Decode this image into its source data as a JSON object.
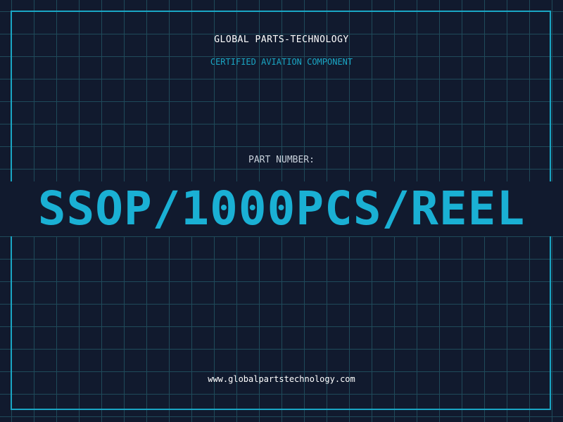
{
  "header": {
    "brand": "GLOBAL PARTS-TECHNOLOGY",
    "subtitle": "CERTIFIED AVIATION COMPONENT"
  },
  "part": {
    "label": "PART NUMBER:",
    "value": "SSOP/1000PCS/REEL"
  },
  "footer": {
    "url": "www.globalpartstechnology.com"
  },
  "colors": {
    "background": "#111a2e",
    "grid": "#1f4a5a",
    "accent": "#1ab0d4",
    "frame": "#1aa6c4",
    "text": "#ffffff"
  }
}
